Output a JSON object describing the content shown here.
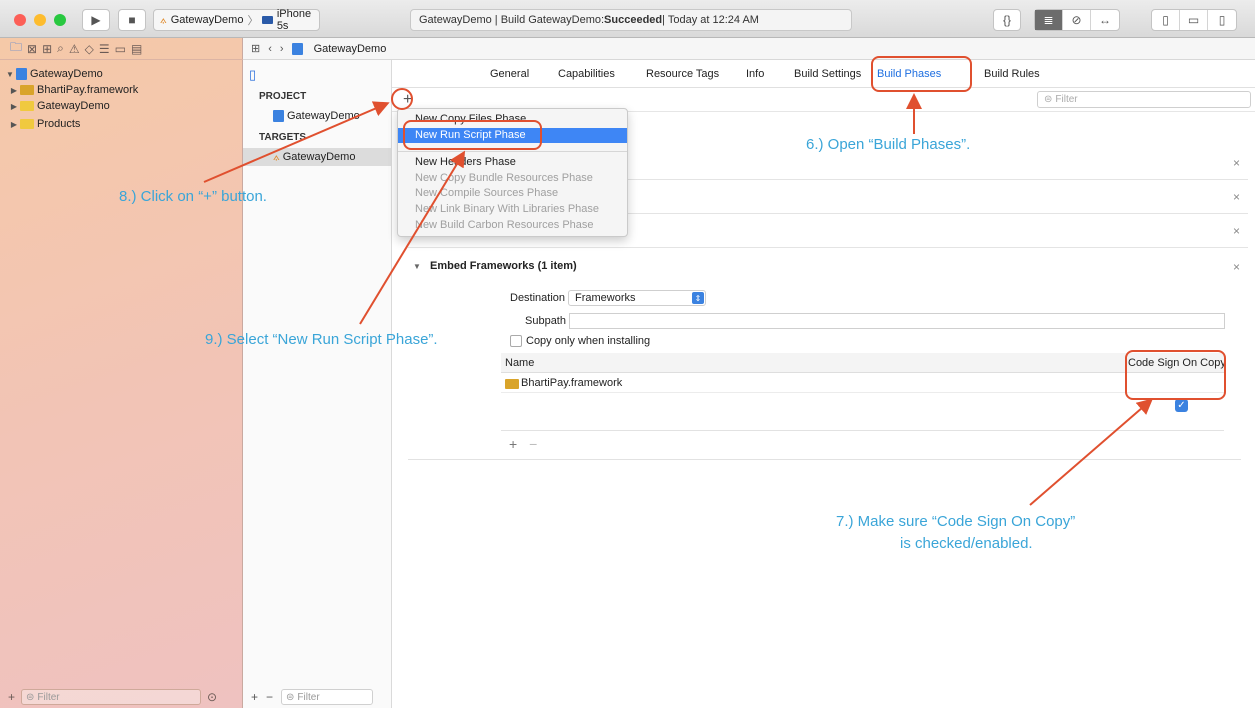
{
  "toolbar": {
    "scheme_target": "GatewayDemo",
    "scheme_device": "iPhone 5s",
    "activity_prefix": "GatewayDemo | Build GatewayDemo: ",
    "activity_status": "Succeeded",
    "activity_suffix": " | Today at 12:24 AM"
  },
  "navigator": {
    "items": [
      {
        "label": "GatewayDemo"
      },
      {
        "label": "BhartiPay.framework"
      },
      {
        "label": "GatewayDemo"
      },
      {
        "label": "Products"
      }
    ],
    "filter_placeholder": "Filter"
  },
  "jumpbar": {
    "project": "GatewayDemo"
  },
  "targets": {
    "project_heading": "PROJECT",
    "project_item": "GatewayDemo",
    "targets_heading": "TARGETS",
    "target_item": "GatewayDemo",
    "filter_placeholder": "Filter"
  },
  "tabs": [
    {
      "label": "General"
    },
    {
      "label": "Capabilities"
    },
    {
      "label": "Resource Tags"
    },
    {
      "label": "Info"
    },
    {
      "label": "Build Settings"
    },
    {
      "label": "Build Phases",
      "active": true
    },
    {
      "label": "Build Rules"
    }
  ],
  "phase_filter_placeholder": "Filter",
  "menu": {
    "items": [
      {
        "label": "New Copy Files Phase",
        "enabled": true
      },
      {
        "label": "New Run Script Phase",
        "enabled": true,
        "highlighted": true
      },
      {
        "label": "New Headers Phase",
        "enabled": true
      },
      {
        "label": "New Copy Bundle Resources Phase",
        "enabled": false
      },
      {
        "label": "New Compile Sources Phase",
        "enabled": false
      },
      {
        "label": "New Link Binary With Libraries Phase",
        "enabled": false
      },
      {
        "label": "New Build Carbon Resources Phase",
        "enabled": false
      }
    ]
  },
  "embed": {
    "title": "Embed Frameworks (1 item)",
    "destination_label": "Destination",
    "destination_value": "Frameworks",
    "subpath_label": "Subpath",
    "copy_only_label": "Copy only when installing",
    "col_name": "Name",
    "col_codesign": "Code Sign On Copy",
    "row_name": "BhartiPay.framework",
    "codesign_checked": true
  },
  "annotations": {
    "step6": "6.) Open “Build Phases”.",
    "step7_line1": "7.) Make sure “Code Sign On Copy”",
    "step7_line2": "is checked/enabled.",
    "step8": "8.) Click on “+” button.",
    "step9": "9.) Select “New Run Script Phase”."
  },
  "colors": {
    "accent": "#1d6ee0",
    "annotation_text": "#3aa5d8",
    "annotation_box": "#e0502f",
    "menu_highlight": "#3e86f5"
  }
}
